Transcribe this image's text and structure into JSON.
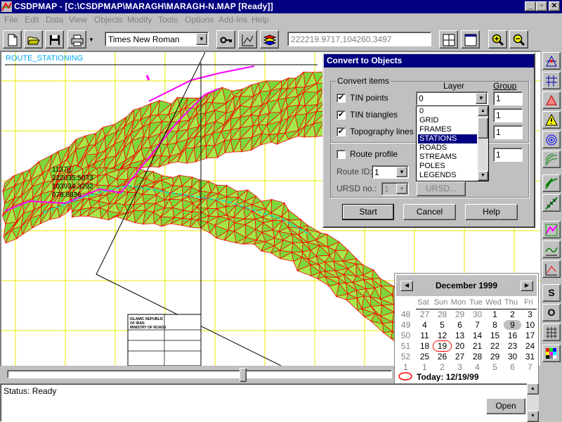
{
  "window": {
    "title": "CSDPMAP - [C:\\CSDPMAP\\MARAGH\\MARAGH-N.MAP [Ready]]",
    "controls": [
      "_",
      "▫",
      "✕"
    ]
  },
  "menu": [
    "File",
    "Edit",
    "Data",
    "View",
    "Objects",
    "Modify",
    "Tools",
    "Options",
    "Add-Ins",
    "Help"
  ],
  "toolbar": {
    "font": "Times New Roman",
    "coordinates": "222219.9717,104260.3497"
  },
  "map": {
    "title": "ROUTE_STATIONING",
    "point_label": [
      "1137[]",
      "222035.5073",
      "103934.3292",
      "978.8836"
    ],
    "titleblock_lines": [
      "ISLAMIC REPUBLIC",
      "OF IRAN",
      "MINISTRY OF ROADS"
    ],
    "colors": {
      "grid": "#e8e800",
      "mesh_red": "#ff0000",
      "mesh_green": "#00c000",
      "route": "#ff00ff",
      "axis": "#00e0e0"
    }
  },
  "dialog": {
    "title": "Convert to Objects",
    "group_label": "Convert items",
    "col_layer": "Layer",
    "col_group": "Group",
    "items": [
      {
        "label": "TIN points",
        "checked": true
      },
      {
        "label": "TIN triangles",
        "checked": true
      },
      {
        "label": "Topography lines",
        "checked": true
      },
      {
        "label": "Route profile",
        "checked": false
      }
    ],
    "layer_value": "0",
    "layer_options": [
      "0",
      "GRID",
      "FRAMES",
      "STATIONS",
      "ROADS",
      "STREAMS",
      "POLES",
      "LEGENDS"
    ],
    "selected_layer": "STATIONS",
    "group_values": [
      "1",
      "1",
      "1",
      "1"
    ],
    "route_id_label": "Route ID:",
    "route_id_value": "1",
    "ursd_label": "URSD no.:",
    "ursd_value": "1",
    "ursd_button": "URSD...",
    "buttons": {
      "start": "Start",
      "cancel": "Cancel",
      "help": "Help"
    }
  },
  "calendar": {
    "month_label": "December 1999",
    "weekdays": [
      "Sat",
      "Sun",
      "Mon",
      "Tue",
      "Wed",
      "Thu",
      "Fri"
    ],
    "weeks": [
      {
        "week": "48",
        "days": [
          "27",
          "28",
          "29",
          "30",
          "1",
          "2",
          "3"
        ]
      },
      {
        "week": "49",
        "days": [
          "4",
          "5",
          "6",
          "7",
          "8",
          "9",
          "10"
        ]
      },
      {
        "week": "50",
        "days": [
          "11",
          "12",
          "13",
          "14",
          "15",
          "16",
          "17"
        ]
      },
      {
        "week": "51",
        "days": [
          "18",
          "19",
          "20",
          "21",
          "22",
          "23",
          "24"
        ]
      },
      {
        "week": "52",
        "days": [
          "25",
          "26",
          "27",
          "28",
          "29",
          "30",
          "31"
        ]
      },
      {
        "week": "1",
        "days": [
          "1",
          "2",
          "3",
          "4",
          "5",
          "6",
          "7"
        ]
      }
    ],
    "today_label": "Today: 12/19/99"
  },
  "status": {
    "text": "Status: Ready",
    "open_button": "Open"
  },
  "right_toolbar_letters": [
    "S",
    "O"
  ]
}
